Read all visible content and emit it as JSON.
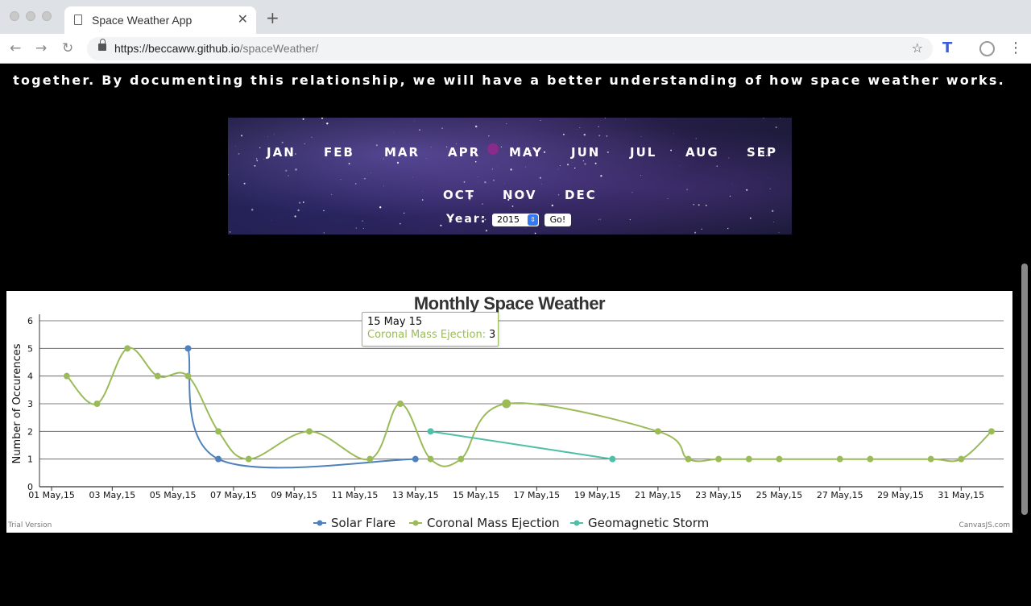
{
  "browser": {
    "tab_title": "Space Weather App",
    "url_host": "https://beccaww.github.io",
    "url_path": "/spaceWeather/"
  },
  "intro_text": "together. By documenting this relationship, we will have a better understanding of how space weather works.",
  "months": [
    "JAN",
    "FEB",
    "MAR",
    "APR",
    "MAY",
    "JUN",
    "JUL",
    "AUG",
    "SEP",
    "OCT",
    "NOV",
    "DEC"
  ],
  "year_label": "Year:",
  "year_value": "2015",
  "go_label": "Go!",
  "tooltip": {
    "date": "15 May 15",
    "series": "Coronal Mass Ejection:",
    "value": "3"
  },
  "trial_label": "Trial Version",
  "credit_label": "CanvasJS.com",
  "colors": {
    "solar": "#4f81bc",
    "cme": "#9bbb59",
    "geo": "#4fbfa8"
  },
  "chart_data": {
    "type": "line",
    "title": "Monthly Space Weather",
    "ylabel": "Number of Occurences",
    "xlabel": "",
    "ylim": [
      0,
      6
    ],
    "y_ticks": [
      "0",
      "1",
      "2",
      "3",
      "4",
      "5",
      "6"
    ],
    "x_ticks": [
      {
        "day": 1,
        "label": "01 May,15"
      },
      {
        "day": 3,
        "label": "03 May,15"
      },
      {
        "day": 5,
        "label": "05 May,15"
      },
      {
        "day": 7,
        "label": "07 May,15"
      },
      {
        "day": 9,
        "label": "09 May,15"
      },
      {
        "day": 11,
        "label": "11 May,15"
      },
      {
        "day": 13,
        "label": "13 May,15"
      },
      {
        "day": 15,
        "label": "15 May,15"
      },
      {
        "day": 17,
        "label": "17 May,15"
      },
      {
        "day": 19,
        "label": "19 May,15"
      },
      {
        "day": 21,
        "label": "21 May,15"
      },
      {
        "day": 23,
        "label": "23 May,15"
      },
      {
        "day": 25,
        "label": "25 May,15"
      },
      {
        "day": 27,
        "label": "27 May,15"
      },
      {
        "day": 29,
        "label": "29 May,15"
      },
      {
        "day": 31,
        "label": "31 May,15"
      }
    ],
    "series": [
      {
        "name": "Solar Flare",
        "color": "#4f81bc",
        "points": [
          [
            5.5,
            5
          ],
          [
            6.5,
            1
          ],
          [
            13,
            1
          ]
        ]
      },
      {
        "name": "Coronal Mass Ejection",
        "color": "#9bbb59",
        "points": [
          [
            1.5,
            4
          ],
          [
            2.5,
            3
          ],
          [
            3.5,
            5
          ],
          [
            4.5,
            4
          ],
          [
            5.5,
            4
          ],
          [
            6.5,
            2
          ],
          [
            7.5,
            1
          ],
          [
            9.5,
            2
          ],
          [
            11.5,
            1
          ],
          [
            12.5,
            3
          ],
          [
            13.5,
            1
          ],
          [
            14.5,
            1
          ],
          [
            16,
            3
          ],
          [
            21,
            2
          ],
          [
            22,
            1
          ],
          [
            23,
            1
          ],
          [
            24,
            1
          ],
          [
            25,
            1
          ],
          [
            27,
            1
          ],
          [
            28,
            1
          ],
          [
            30,
            1
          ],
          [
            31,
            1
          ],
          [
            32,
            2
          ]
        ]
      },
      {
        "name": "Geomagnetic Storm",
        "color": "#4fbfa8",
        "points": [
          [
            13.5,
            2
          ],
          [
            19.5,
            1
          ]
        ]
      }
    ],
    "legend_position": "bottom-center",
    "grid": true
  }
}
